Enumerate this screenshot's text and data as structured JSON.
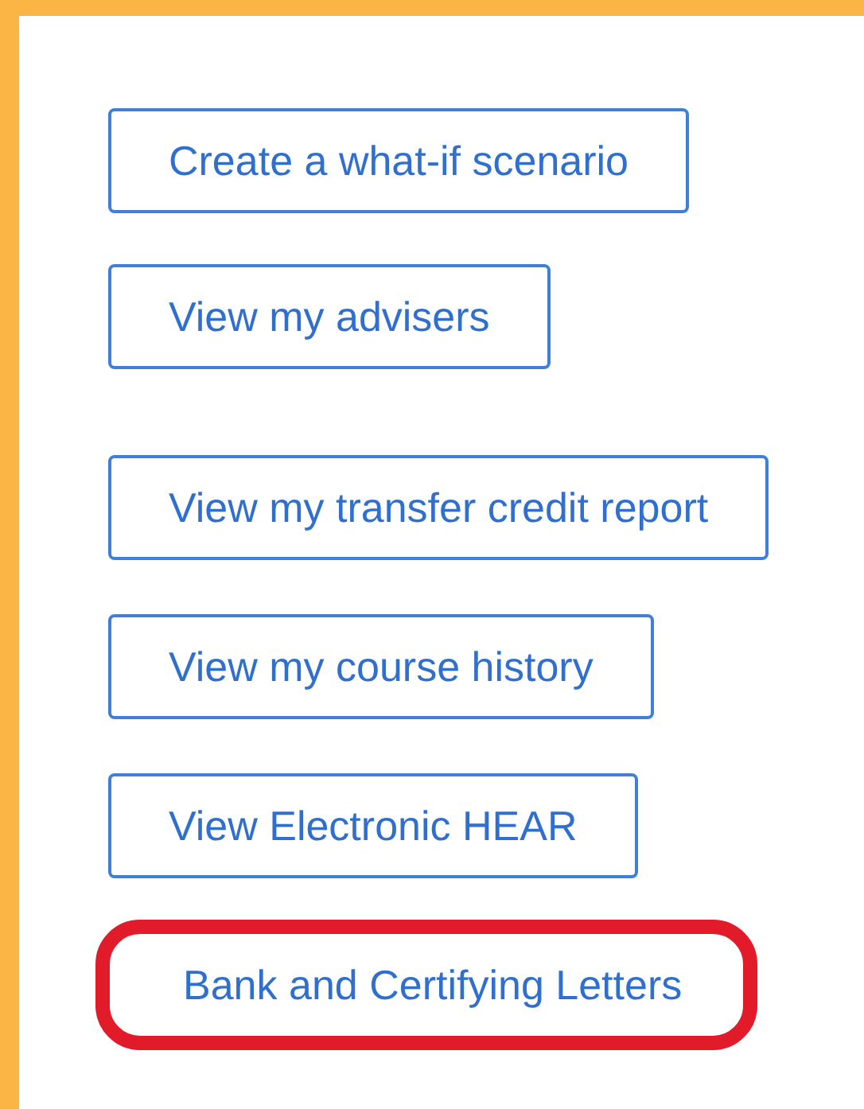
{
  "buttons": [
    {
      "label": "Create a what-if scenario",
      "highlighted": false
    },
    {
      "label": "View my advisers",
      "highlighted": false
    },
    {
      "label": "View my transfer credit report",
      "highlighted": false
    },
    {
      "label": "View my course history",
      "highlighted": false
    },
    {
      "label": "View Electronic HEAR",
      "highlighted": false
    },
    {
      "label": "Bank and Certifying Letters",
      "highlighted": true
    }
  ]
}
